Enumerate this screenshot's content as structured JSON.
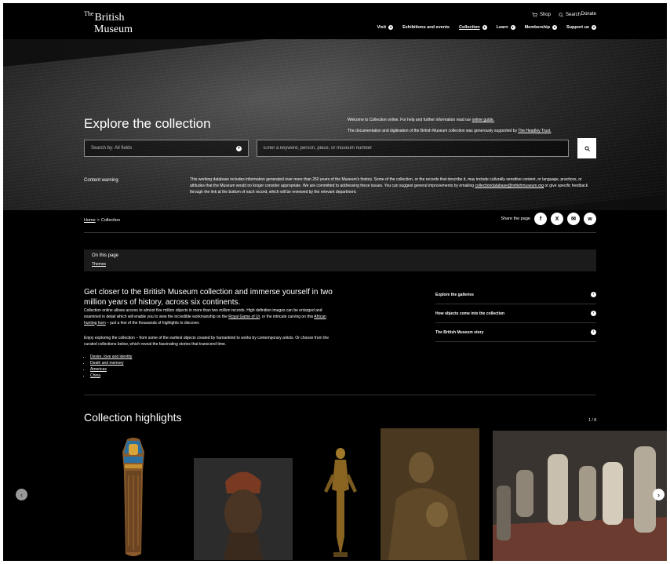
{
  "header": {
    "logo": {
      "the": "The",
      "line1": "British",
      "line2": "Museum"
    },
    "utility": {
      "shop": "Shop",
      "search": "Search",
      "donate": "Donate"
    },
    "nav": [
      {
        "label": "Visit"
      },
      {
        "label": "Exhibitions and events"
      },
      {
        "label": "Collection"
      },
      {
        "label": "Learn"
      },
      {
        "label": "Membership"
      },
      {
        "label": "Support us"
      }
    ]
  },
  "hero": {
    "title": "Explore the collection",
    "welcome_pre": "Welcome to Collection online. For help and further information read our ",
    "welcome_link": "online guide.",
    "support_pre": "The documentation and digitisation of the British Museum collection was generously supported by ",
    "support_link": "The Headley Trust.",
    "search_by": "Search by: All fields",
    "keyword_placeholder": "Enter a keyword, person, place, or museum number",
    "content_warning_label": "Content warning",
    "content_warning_pre": "This working database includes information generated over more than 250 years of the Museum's history. Some of the collection, or the records that describe it, may include culturally sensitive content, or language, practices, or attitudes that the Museum would no longer consider appropriate. We are committed to addressing these issues. You can suggest general improvements by emailing ",
    "content_warning_email": "collectiondatabase@britishmuseum.org",
    "content_warning_post": " or give specific feedback through the link at the bottom of each record, which will be reviewed by the relevant department."
  },
  "breadcrumb": {
    "home": "Home",
    "sep": ">",
    "current": "Collection"
  },
  "share": {
    "label": "Share the page",
    "icons": [
      "f",
      "X",
      "✉",
      "w"
    ]
  },
  "on_this_page": {
    "heading": "On this page",
    "link": "Themes"
  },
  "intro": {
    "heading": "Get closer to the British Museum collection and immerse yourself in two million years of history, across six continents.",
    "p1_pre": "Collection online allows access to almost five million objects in more than two million records. High definition images can be enlarged and examined in detail which will enable you to view the incredible workmanship on the ",
    "p1_link1": "Royal Game of Ur",
    "p1_mid": ", or the intricate carving on this ",
    "p1_link2": "African hunting horn",
    "p1_post": " – just a few of the thousands of highlights to discover.",
    "p2": "Enjoy exploring the collection – from some of the earliest objects created by humankind to works by contemporary artists. Or choose from the curated collections below, which reveal the fascinating stories that transcend time.",
    "themes": [
      "Desire, love and identity",
      "Death and memory",
      "Americas",
      "China"
    ]
  },
  "side_links": [
    "Explore the galleries",
    "How objects come into the collection",
    "The British Museum story"
  ],
  "highlights": {
    "title": "Collection highlights",
    "counter": "1 / 8"
  }
}
